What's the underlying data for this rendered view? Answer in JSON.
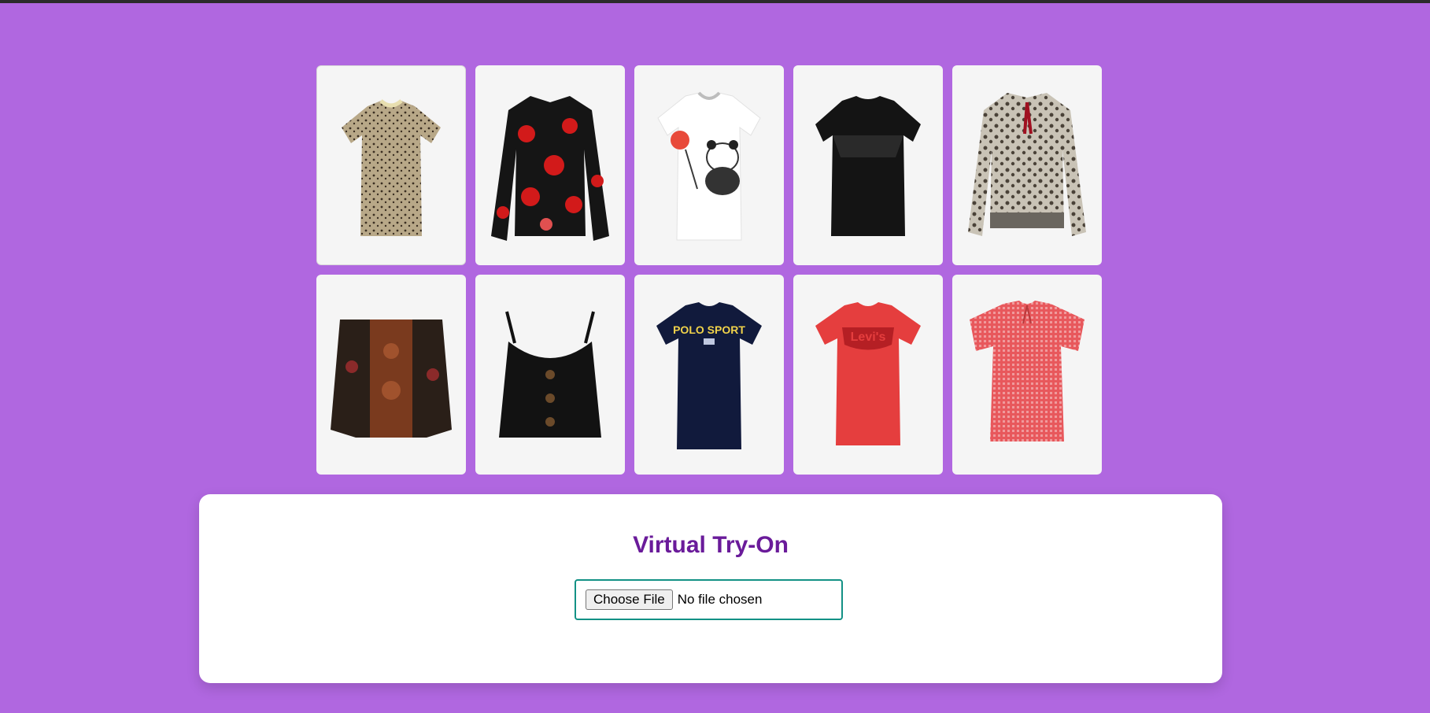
{
  "garments": [
    {
      "icon": "leopard-tshirt-icon",
      "color": "#b8a888"
    },
    {
      "icon": "floral-blouse-icon",
      "color": "#c41a1a"
    },
    {
      "icon": "panda-tshirt-icon",
      "color": "#ffffff"
    },
    {
      "icon": "black-lace-top-icon",
      "color": "#111111"
    },
    {
      "icon": "leopard-blouse-icon",
      "color": "#8a8478"
    },
    {
      "icon": "paisley-offshoulder-top-icon",
      "color": "#6b3a22"
    },
    {
      "icon": "black-button-cami-icon",
      "color": "#111111"
    },
    {
      "icon": "navy-polo-sport-tshirt-icon",
      "color": "#111a3c",
      "print": "POLO SPORT"
    },
    {
      "icon": "red-levis-tshirt-icon",
      "color": "#e53e3e",
      "print": "Levi's"
    },
    {
      "icon": "red-gingham-blouse-icon",
      "color": "#e8585c"
    }
  ],
  "tryon": {
    "title": "Virtual Try-On",
    "file_button": "Choose File",
    "file_status": "No file chosen"
  },
  "colors": {
    "background": "#b067e0",
    "title": "#6a1b9a",
    "input_border": "#139185"
  }
}
